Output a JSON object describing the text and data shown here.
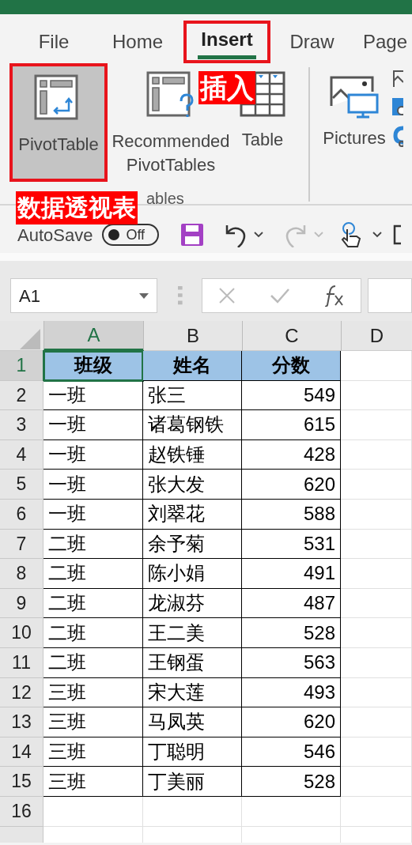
{
  "tabs": [
    {
      "label": "File",
      "selected": false,
      "highlighted": false
    },
    {
      "label": "Home",
      "selected": false,
      "highlighted": false
    },
    {
      "label": "Insert",
      "selected": true,
      "highlighted": true
    },
    {
      "label": "Draw",
      "selected": false,
      "highlighted": false
    },
    {
      "label": "Page",
      "selected": false,
      "highlighted": false
    }
  ],
  "ribbon": {
    "buttons": [
      {
        "kind": "pivot",
        "label": "PivotTable",
        "selected": true,
        "highlighted": true
      },
      {
        "kind": "recommended",
        "label": "Recommended PivotTables",
        "selected": false,
        "highlighted": false
      },
      {
        "kind": "table",
        "label": "Table",
        "selected": false,
        "highlighted": false
      }
    ],
    "group_label": "ables",
    "pictures_label": "Pictures"
  },
  "annotations": [
    {
      "kind": "insert",
      "text": "插入"
    },
    {
      "kind": "pivot",
      "text": "数据透视表"
    }
  ],
  "quick_access": {
    "autosave_label": "AutoSave",
    "toggle": {
      "label": "Off",
      "on": false
    },
    "redo_disabled": true
  },
  "name_box": "A1",
  "columns": [
    {
      "label": "A",
      "selected": true
    },
    {
      "label": "B",
      "selected": false
    },
    {
      "label": "C",
      "selected": false
    },
    {
      "label": "D",
      "selected": false
    }
  ],
  "rows": [
    {
      "number": "1",
      "kind": "header",
      "selected": true,
      "cells": [
        "班级",
        "姓名",
        "分数"
      ]
    },
    {
      "number": "2",
      "kind": "data",
      "selected": false,
      "cells": [
        "一班",
        "张三",
        "549"
      ]
    },
    {
      "number": "3",
      "kind": "data",
      "selected": false,
      "cells": [
        "一班",
        "诸葛钢铁",
        "615"
      ]
    },
    {
      "number": "4",
      "kind": "data",
      "selected": false,
      "cells": [
        "一班",
        "赵铁锤",
        "428"
      ]
    },
    {
      "number": "5",
      "kind": "data",
      "selected": false,
      "cells": [
        "一班",
        "张大发",
        "620"
      ]
    },
    {
      "number": "6",
      "kind": "data",
      "selected": false,
      "cells": [
        "一班",
        "刘翠花",
        "588"
      ]
    },
    {
      "number": "7",
      "kind": "data",
      "selected": false,
      "cells": [
        "二班",
        "余予菊",
        "531"
      ]
    },
    {
      "number": "8",
      "kind": "data",
      "selected": false,
      "cells": [
        "二班",
        "陈小娟",
        "491"
      ]
    },
    {
      "number": "9",
      "kind": "data",
      "selected": false,
      "cells": [
        "二班",
        "龙淑芬",
        "487"
      ]
    },
    {
      "number": "10",
      "kind": "data",
      "selected": false,
      "cells": [
        "二班",
        "王二美",
        "528"
      ]
    },
    {
      "number": "11",
      "kind": "data",
      "selected": false,
      "cells": [
        "二班",
        "王钢蛋",
        "563"
      ]
    },
    {
      "number": "12",
      "kind": "data",
      "selected": false,
      "cells": [
        "三班",
        "宋大莲",
        "493"
      ]
    },
    {
      "number": "13",
      "kind": "data",
      "selected": false,
      "cells": [
        "三班",
        "马凤英",
        "620"
      ]
    },
    {
      "number": "14",
      "kind": "data",
      "selected": false,
      "cells": [
        "三班",
        "丁聪明",
        "546"
      ]
    },
    {
      "number": "15",
      "kind": "data",
      "selected": false,
      "cells": [
        "三班",
        "丁美丽",
        "528"
      ]
    },
    {
      "number": "16",
      "kind": "empty",
      "selected": false,
      "cells": []
    }
  ]
}
